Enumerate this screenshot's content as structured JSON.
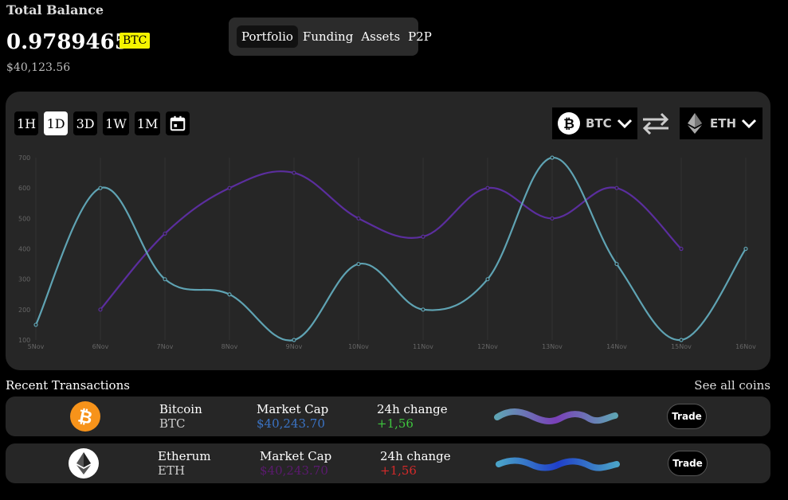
{
  "balance": {
    "title": "Total Balance",
    "amount": "0.97894652",
    "currency_badge": "BTC",
    "usd": "$40,123.56"
  },
  "top_tabs": [
    {
      "label": "Portfolio",
      "active": true
    },
    {
      "label": "Funding",
      "active": false
    },
    {
      "label": "Assets",
      "active": false
    },
    {
      "label": "P2P",
      "active": false
    }
  ],
  "range_buttons": [
    {
      "label": "1H",
      "active": false
    },
    {
      "label": "1D",
      "active": true
    },
    {
      "label": "3D",
      "active": false
    },
    {
      "label": "1W",
      "active": false
    },
    {
      "label": "1M",
      "active": false
    }
  ],
  "pair": {
    "from": {
      "label": "BTC",
      "icon": "bitcoin-icon"
    },
    "to": {
      "label": "ETH",
      "icon": "ethereum-icon"
    }
  },
  "chart_data": {
    "type": "line",
    "categories": [
      "5Nov",
      "6Nov",
      "7Nov",
      "8Nov",
      "9Nov",
      "10Nov",
      "11Nov",
      "12Nov",
      "13Nov",
      "14Nov",
      "15Nov",
      "16Nov"
    ],
    "yticks": [
      100,
      200,
      300,
      400,
      500,
      600,
      700
    ],
    "ylim": [
      100,
      700
    ],
    "grid": true,
    "series": [
      {
        "color": "#5b2e9e",
        "values": [
          null,
          200,
          450,
          600,
          650,
          500,
          440,
          600,
          500,
          600,
          400,
          null
        ]
      },
      {
        "color": "#5fa3b3",
        "values": [
          150,
          600,
          300,
          250,
          100,
          350,
          200,
          300,
          700,
          350,
          100,
          400
        ]
      }
    ]
  },
  "recent": {
    "title": "Recent Transactions",
    "see_all": "See all coins",
    "rows": [
      {
        "name": "Bitcoin",
        "symbol": "BTC",
        "market_cap_label": "Market Cap",
        "market_cap": "$40,243.70",
        "market_cap_color": "#3a73c4",
        "change_label": "24h change",
        "change": "+1,56",
        "change_color": "#3ec63e",
        "trade_label": "Trade",
        "logo_color": "#f7931a",
        "icon": "bitcoin-icon"
      },
      {
        "name": "Etherum",
        "symbol": "ETH",
        "market_cap_label": "Market Cap",
        "market_cap": "$40,243.70",
        "market_cap_color": "#5a1a6e",
        "change_label": "24h change",
        "change": "+1,56",
        "change_color": "#d42a2a",
        "trade_label": "Trade",
        "logo_color": "#ffffff",
        "icon": "ethereum-icon"
      }
    ]
  }
}
